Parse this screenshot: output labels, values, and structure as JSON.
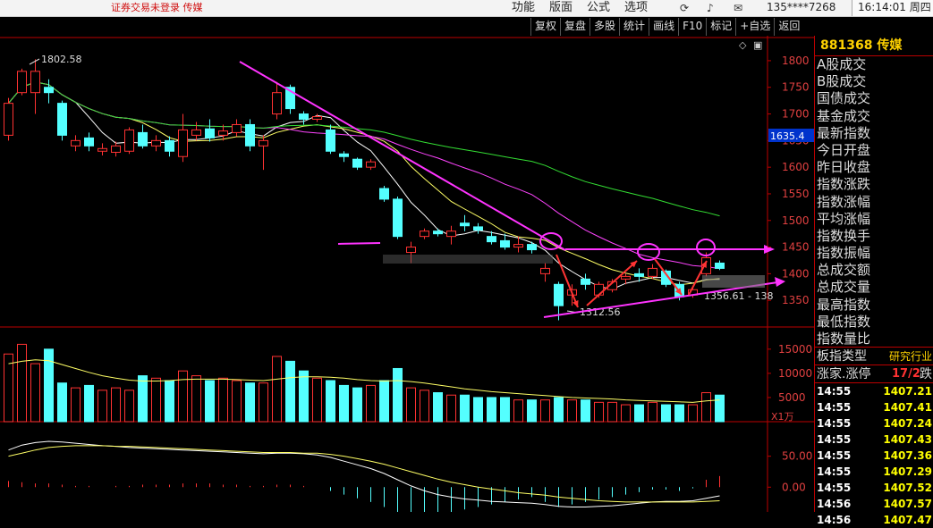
{
  "topbar": {
    "warning": "证券交易未登录  传媒",
    "menu": [
      "功能",
      "版面",
      "公式",
      "选项"
    ],
    "account": "135****7268",
    "clock": "16:14:01 周四"
  },
  "toolbar": [
    "复权",
    "复盘",
    "多股",
    "统计",
    "画线",
    "F10",
    "标记",
    "+自选",
    "返回"
  ],
  "stock": {
    "code": "881368",
    "name": "传媒"
  },
  "right_panel": {
    "items": [
      "A股成交",
      "B股成交",
      "国债成交",
      "基金成交",
      "最新指数",
      "今日开盘",
      "昨日收盘",
      "指数涨跌",
      "指数涨幅",
      "平均涨幅",
      "指数换手",
      "指数振幅",
      "总成交额",
      "总成交量",
      "最高指数",
      "最低指数",
      "指数量比"
    ],
    "type_label": "板指类型",
    "type_value": "研究行业",
    "limit_label": "涨家.涨停",
    "limit_value": "17/2",
    "limit_suffix": "跌",
    "ticks": [
      {
        "time": "14:55",
        "price": "1407.21"
      },
      {
        "time": "14:55",
        "price": "1407.41"
      },
      {
        "time": "14:55",
        "price": "1407.24"
      },
      {
        "time": "14:55",
        "price": "1407.43"
      },
      {
        "time": "14:55",
        "price": "1407.36"
      },
      {
        "time": "14:55",
        "price": "1407.29"
      },
      {
        "time": "14:55",
        "price": "1407.52"
      },
      {
        "time": "14:56",
        "price": "1407.57"
      },
      {
        "time": "14:56",
        "price": "1407.47"
      }
    ]
  },
  "colors": {
    "up": "#ff3232",
    "down": "#54ffff",
    "trend": "#ff33ff",
    "price_tag": "#0033cc"
  },
  "chart_data": {
    "type": "candlestick",
    "price_axis": {
      "ticks": [
        1800,
        1750,
        1700,
        1650,
        1600,
        1550,
        1500,
        1450,
        1400,
        1350
      ],
      "range": [
        1300,
        1820
      ]
    },
    "current_price_label": "1635.4",
    "annotations": {
      "high": "1802.58",
      "low": "1312.56",
      "recent_low": "1356.61 - 138"
    },
    "candles": [
      {
        "o": 1660,
        "c": 1720,
        "h": 1730,
        "l": 1650
      },
      {
        "o": 1740,
        "c": 1780,
        "h": 1785,
        "l": 1735
      },
      {
        "o": 1740,
        "c": 1780,
        "h": 1802.58,
        "l": 1700
      },
      {
        "o": 1750,
        "c": 1740,
        "h": 1765,
        "l": 1720
      },
      {
        "o": 1720,
        "c": 1660,
        "h": 1725,
        "l": 1650
      },
      {
        "o": 1640,
        "c": 1650,
        "h": 1660,
        "l": 1630
      },
      {
        "o": 1655,
        "c": 1640,
        "h": 1665,
        "l": 1630
      },
      {
        "o": 1630,
        "c": 1635,
        "h": 1645,
        "l": 1622
      },
      {
        "o": 1628,
        "c": 1640,
        "h": 1648,
        "l": 1620
      },
      {
        "o": 1630,
        "c": 1670,
        "h": 1675,
        "l": 1625
      },
      {
        "o": 1665,
        "c": 1640,
        "h": 1680,
        "l": 1635
      },
      {
        "o": 1640,
        "c": 1650,
        "h": 1660,
        "l": 1630
      },
      {
        "o": 1650,
        "c": 1630,
        "h": 1658,
        "l": 1620
      },
      {
        "o": 1620,
        "c": 1670,
        "h": 1700,
        "l": 1610
      },
      {
        "o": 1660,
        "c": 1670,
        "h": 1685,
        "l": 1650
      },
      {
        "o": 1672,
        "c": 1655,
        "h": 1690,
        "l": 1648
      },
      {
        "o": 1660,
        "c": 1668,
        "h": 1680,
        "l": 1650
      },
      {
        "o": 1665,
        "c": 1680,
        "h": 1690,
        "l": 1658
      },
      {
        "o": 1680,
        "c": 1640,
        "h": 1690,
        "l": 1630
      },
      {
        "o": 1640,
        "c": 1650,
        "h": 1660,
        "l": 1595
      },
      {
        "o": 1700,
        "c": 1740,
        "h": 1760,
        "l": 1690
      },
      {
        "o": 1750,
        "c": 1710,
        "h": 1755,
        "l": 1700
      },
      {
        "o": 1700,
        "c": 1690,
        "h": 1705,
        "l": 1680
      },
      {
        "o": 1690,
        "c": 1695,
        "h": 1700,
        "l": 1685
      },
      {
        "o": 1670,
        "c": 1630,
        "h": 1680,
        "l": 1625
      },
      {
        "o": 1625,
        "c": 1620,
        "h": 1630,
        "l": 1610
      },
      {
        "o": 1615,
        "c": 1600,
        "h": 1618,
        "l": 1595
      },
      {
        "o": 1600,
        "c": 1610,
        "h": 1615,
        "l": 1595
      },
      {
        "o": 1560,
        "c": 1540,
        "h": 1565,
        "l": 1535
      },
      {
        "o": 1540,
        "c": 1470,
        "h": 1545,
        "l": 1465
      },
      {
        "o": 1440,
        "c": 1450,
        "h": 1460,
        "l": 1420
      },
      {
        "o": 1470,
        "c": 1480,
        "h": 1485,
        "l": 1465
      },
      {
        "o": 1480,
        "c": 1475,
        "h": 1485,
        "l": 1470
      },
      {
        "o": 1470,
        "c": 1480,
        "h": 1490,
        "l": 1455
      },
      {
        "o": 1495,
        "c": 1490,
        "h": 1510,
        "l": 1480
      },
      {
        "o": 1488,
        "c": 1482,
        "h": 1495,
        "l": 1475
      },
      {
        "o": 1470,
        "c": 1460,
        "h": 1480,
        "l": 1455
      },
      {
        "o": 1462,
        "c": 1450,
        "h": 1475,
        "l": 1445
      },
      {
        "o": 1450,
        "c": 1455,
        "h": 1470,
        "l": 1440
      },
      {
        "o": 1455,
        "c": 1445,
        "h": 1460,
        "l": 1438
      },
      {
        "o": 1400,
        "c": 1410,
        "h": 1420,
        "l": 1385
      },
      {
        "o": 1380,
        "c": 1340,
        "h": 1385,
        "l": 1312.56
      },
      {
        "o": 1360,
        "c": 1370,
        "h": 1380,
        "l": 1340
      },
      {
        "o": 1390,
        "c": 1380,
        "h": 1400,
        "l": 1370
      },
      {
        "o": 1360,
        "c": 1380,
        "h": 1385,
        "l": 1355
      },
      {
        "o": 1370,
        "c": 1385,
        "h": 1390,
        "l": 1365
      },
      {
        "o": 1390,
        "c": 1395,
        "h": 1400,
        "l": 1380
      },
      {
        "o": 1400,
        "c": 1395,
        "h": 1410,
        "l": 1385
      },
      {
        "o": 1395,
        "c": 1410,
        "h": 1418,
        "l": 1390
      },
      {
        "o": 1405,
        "c": 1380,
        "h": 1408,
        "l": 1375
      },
      {
        "o": 1380,
        "c": 1356.61,
        "h": 1385,
        "l": 1350
      },
      {
        "o": 1360,
        "c": 1370,
        "h": 1375,
        "l": 1355
      },
      {
        "o": 1400,
        "c": 1430,
        "h": 1440,
        "l": 1395
      },
      {
        "o": 1420,
        "c": 1410,
        "h": 1425,
        "l": 1407
      }
    ],
    "volume_axis": {
      "ticks": [
        15000,
        10000,
        5000
      ],
      "unit_label": "X1万",
      "range": [
        0,
        17000
      ]
    },
    "volumes": [
      14000,
      16000,
      12000,
      15000,
      8000,
      7000,
      7500,
      6500,
      7000,
      6500,
      9500,
      9000,
      8500,
      10500,
      9500,
      8500,
      9000,
      8500,
      8000,
      8000,
      13500,
      12500,
      10500,
      9000,
      8500,
      7500,
      7000,
      7500,
      8500,
      11000,
      7000,
      6500,
      6000,
      5500,
      5500,
      5000,
      5000,
      5000,
      4500,
      4500,
      4500,
      5000,
      4500,
      4500,
      4000,
      4000,
      3500,
      3500,
      4000,
      3500,
      3500,
      3500,
      6000,
      5500
    ],
    "ma_volume": [
      12000,
      12500,
      12800,
      12600,
      11800,
      11000,
      10200,
      9500,
      9000,
      8600,
      8400,
      8400,
      8500,
      8700,
      8800,
      8800,
      8800,
      8700,
      8600,
      8500,
      8800,
      9100,
      9300,
      9300,
      9200,
      9000,
      8700,
      8500,
      8400,
      8500,
      8300,
      8000,
      7600,
      7200,
      6800,
      6500,
      6200,
      6000,
      5800,
      5600,
      5400,
      5200,
      5000,
      4900,
      4800,
      4700,
      4500,
      4400,
      4300,
      4200,
      4100,
      4000,
      4300,
      4500
    ],
    "macd_axis": {
      "ticks": [
        50.0,
        0.0
      ],
      "range": [
        -40,
        100
      ]
    },
    "macd_hist": [
      5,
      4,
      3,
      3,
      2,
      1,
      1,
      0,
      1,
      1,
      2,
      2,
      2,
      3,
      3,
      3,
      2,
      2,
      1,
      1,
      2,
      2,
      1,
      0,
      -3,
      -6,
      -9,
      -12,
      -16,
      -22,
      -26,
      -24,
      -22,
      -20,
      -18,
      -16,
      -14,
      -12,
      -10,
      -8,
      -12,
      -16,
      -14,
      -12,
      -10,
      -8,
      -6,
      -4,
      -2,
      -2,
      -3,
      -1,
      6,
      9
    ],
    "macd_dif": [
      60,
      68,
      72,
      74,
      73,
      71,
      69,
      67,
      66,
      64,
      63,
      62,
      61,
      60,
      59,
      58,
      57,
      56,
      55,
      54,
      55,
      55,
      54,
      52,
      48,
      42,
      36,
      30,
      22,
      12,
      2,
      -6,
      -12,
      -16,
      -19,
      -21,
      -23,
      -24,
      -25,
      -26,
      -28,
      -31,
      -32,
      -32,
      -31,
      -30,
      -28,
      -26,
      -24,
      -23,
      -23,
      -22,
      -18,
      -14
    ],
    "macd_dea": [
      50,
      55,
      60,
      64,
      66,
      67,
      67,
      67,
      66,
      66,
      65,
      64,
      63,
      62,
      61,
      60,
      59,
      58,
      57,
      56,
      56,
      56,
      55,
      55,
      53,
      50,
      46,
      42,
      37,
      31,
      25,
      19,
      13,
      8,
      4,
      0,
      -3,
      -6,
      -9,
      -11,
      -13,
      -16,
      -18,
      -20,
      -22,
      -23,
      -24,
      -24,
      -24,
      -24,
      -24,
      -24,
      -23,
      -22
    ]
  }
}
